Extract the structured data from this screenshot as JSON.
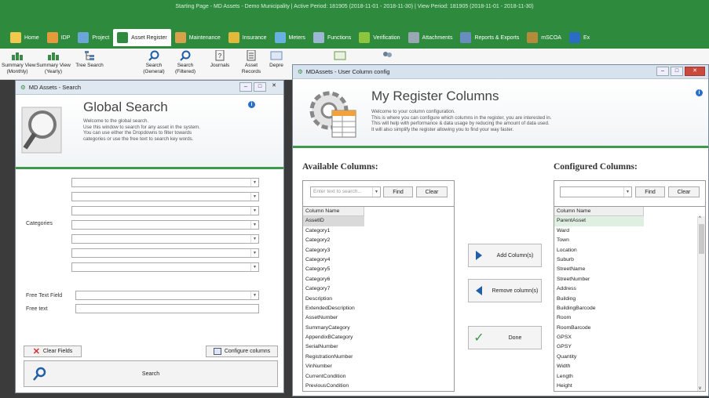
{
  "app_title": "Starting Page - MD Assets - Demo Municipality  |  Active Period: 181905 (2018-11-01 - 2018-11-30)  |  View Period: 181905 (2018-11-01 - 2018-11-30)",
  "ribbon_tabs": [
    {
      "label": "Home",
      "icon": "home-icon",
      "color": "#f2c94c"
    },
    {
      "label": "IDP",
      "icon": "idp-icon",
      "color": "#e59a3b"
    },
    {
      "label": "Project",
      "icon": "project-icon",
      "color": "#6aa6d8"
    },
    {
      "label": "Asset Register",
      "icon": "dollar-icon",
      "color": "#2f8b3f"
    },
    {
      "label": "Maintenance",
      "icon": "maintenance-icon",
      "color": "#d9a14a"
    },
    {
      "label": "Insurance",
      "icon": "insurance-icon",
      "color": "#e2b93b"
    },
    {
      "label": "Meters",
      "icon": "meter-icon",
      "color": "#6bb0e3"
    },
    {
      "label": "Functions",
      "icon": "functions-icon",
      "color": "#9fb7d6"
    },
    {
      "label": "Verification",
      "icon": "check-icon",
      "color": "#8cc63f"
    },
    {
      "label": "Attachments",
      "icon": "paperclip-icon",
      "color": "#9aa8b5"
    },
    {
      "label": "Reports & Exports",
      "icon": "report-icon",
      "color": "#6a8dbf"
    },
    {
      "label": "mSCOA",
      "icon": "mscoa-icon",
      "color": "#b58a3a"
    },
    {
      "label": "Ex",
      "icon": "globe-icon",
      "color": "#2b6cc4"
    }
  ],
  "toolbar": {
    "summary_view_1": "Summary View\n(Monthly)",
    "summary_view_2": "Summary View\n(Yearly)",
    "tree_search": "Tree Search",
    "search_general": "Search\n(General)",
    "search_filtered": "Search\n(Filtered)",
    "journals": "Journals",
    "asset_records": "Asset\nRecords",
    "depre": "Depre"
  },
  "search_window": {
    "title": "MD Assets - Search",
    "heading": "Global Search",
    "description": "Welcome to the global search.\nUse this window to search for any asset in the system.\nYou can use either the Dropdowns to filter towards\ncategories or use the free text to search key words.",
    "categories_label": "Categories",
    "free_text_field_label": "Free Text Field",
    "free_text_label": "Free text",
    "clear_fields": "Clear Fields",
    "configure_columns": "Configure columns",
    "search": "Search"
  },
  "column_window": {
    "title": "MDAssets - User Column config",
    "heading": "My Register Columns",
    "description": "Welcome to your column configuration.\nThis is where you can configure which columns in the register, you are interested in.\nThis will help with performance & data usage by reducing the amount of data used.\nIt will also simplify the register allowing you to find your way faster.",
    "available_heading": "Available Columns:",
    "configured_heading": "Configured Columns:",
    "search_placeholder": "Enter text to search...",
    "find": "Find",
    "clear": "Clear",
    "column_name_header": "Column Name",
    "add_column": "Add Column(s)",
    "remove_column": "Remove column(s)",
    "done": "Done",
    "available_columns": [
      "AssetID",
      "Category1",
      "Category2",
      "Category3",
      "Category4",
      "Category5",
      "Category6",
      "Category7",
      "Description",
      "ExtendedDescription",
      "AssetNumber",
      "SummaryCategory",
      "AppendixBCategory",
      "SerialNumber",
      "RegistrationNumber",
      "VinNumber",
      "CurrentCondition",
      "PreviousCondition"
    ],
    "configured_columns": [
      "ParentAsset",
      "Ward",
      "Town",
      "Location",
      "Suburb",
      "StreetName",
      "StreetNumber",
      "Address",
      "Building",
      "BuildingBarcode",
      "Room",
      "RoomBarcode",
      "GPSX",
      "GPSY",
      "Quantity",
      "Width",
      "Length",
      "Height"
    ]
  }
}
